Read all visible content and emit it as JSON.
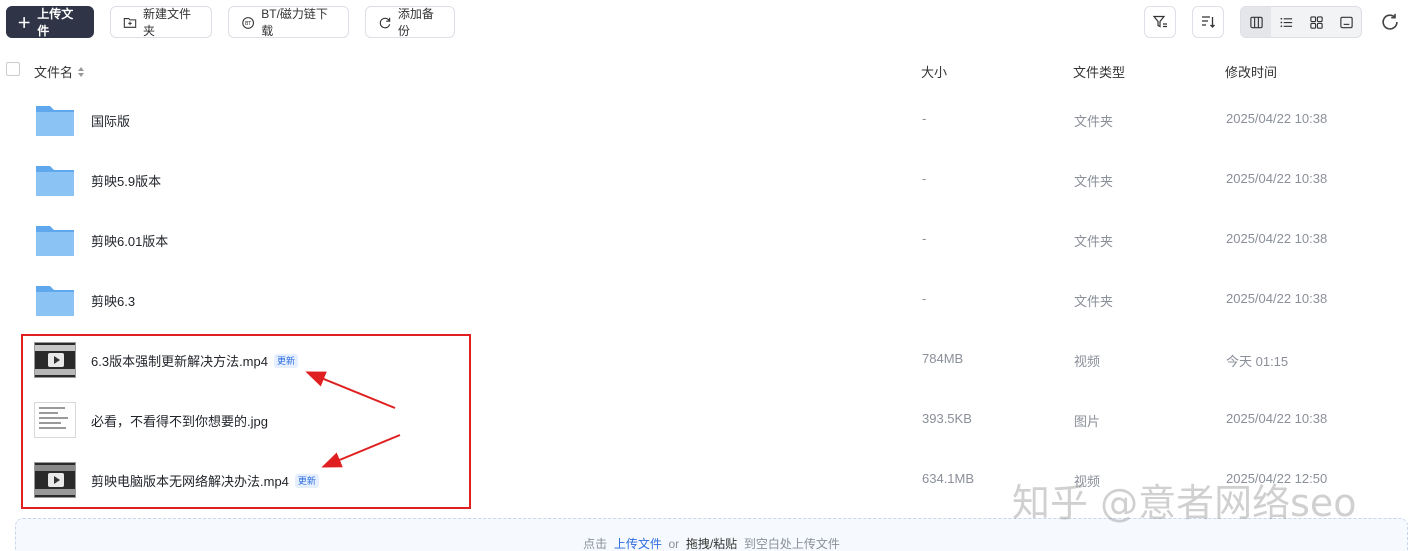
{
  "toolbar": {
    "upload_label": "上传文件",
    "new_folder_label": "新建文件夹",
    "bt_label": "BT/磁力链下载",
    "backup_label": "添加备份"
  },
  "table": {
    "columns": {
      "name": "文件名",
      "size": "大小",
      "type": "文件类型",
      "modified": "修改时间"
    },
    "rows": [
      {
        "name": "国际版",
        "size": "-",
        "type": "文件夹",
        "modified": "2025/04/22 10:38",
        "kind": "folder",
        "badge": ""
      },
      {
        "name": "剪映5.9版本",
        "size": "-",
        "type": "文件夹",
        "modified": "2025/04/22 10:38",
        "kind": "folder",
        "badge": ""
      },
      {
        "name": "剪映6.01版本",
        "size": "-",
        "type": "文件夹",
        "modified": "2025/04/22 10:38",
        "kind": "folder",
        "badge": ""
      },
      {
        "name": "剪映6.3",
        "size": "-",
        "type": "文件夹",
        "modified": "2025/04/22 10:38",
        "kind": "folder",
        "badge": ""
      },
      {
        "name": "6.3版本强制更新解决方法.mp4",
        "size": "784MB",
        "type": "视频",
        "modified": "今天 01:15",
        "kind": "video",
        "badge": "更新"
      },
      {
        "name": "必看，不看得不到你想要的.jpg",
        "size": "393.5KB",
        "type": "图片",
        "modified": "2025/04/22 10:38",
        "kind": "image",
        "badge": ""
      },
      {
        "name": "剪映电脑版本无网络解决办法.mp4",
        "size": "634.1MB",
        "type": "视频",
        "modified": "2025/04/22 12:50",
        "kind": "video",
        "badge": "更新"
      }
    ]
  },
  "dropzone": {
    "prefix": "点击",
    "upload_link": "上传文件",
    "or": "or",
    "paste": "拖拽/粘贴",
    "suffix": "到空白处上传文件"
  },
  "watermark": "知乎 @意者网络seo",
  "colors": {
    "primary_button": "#2f3447",
    "highlight": "#e02020",
    "link": "#2d6cdf"
  }
}
